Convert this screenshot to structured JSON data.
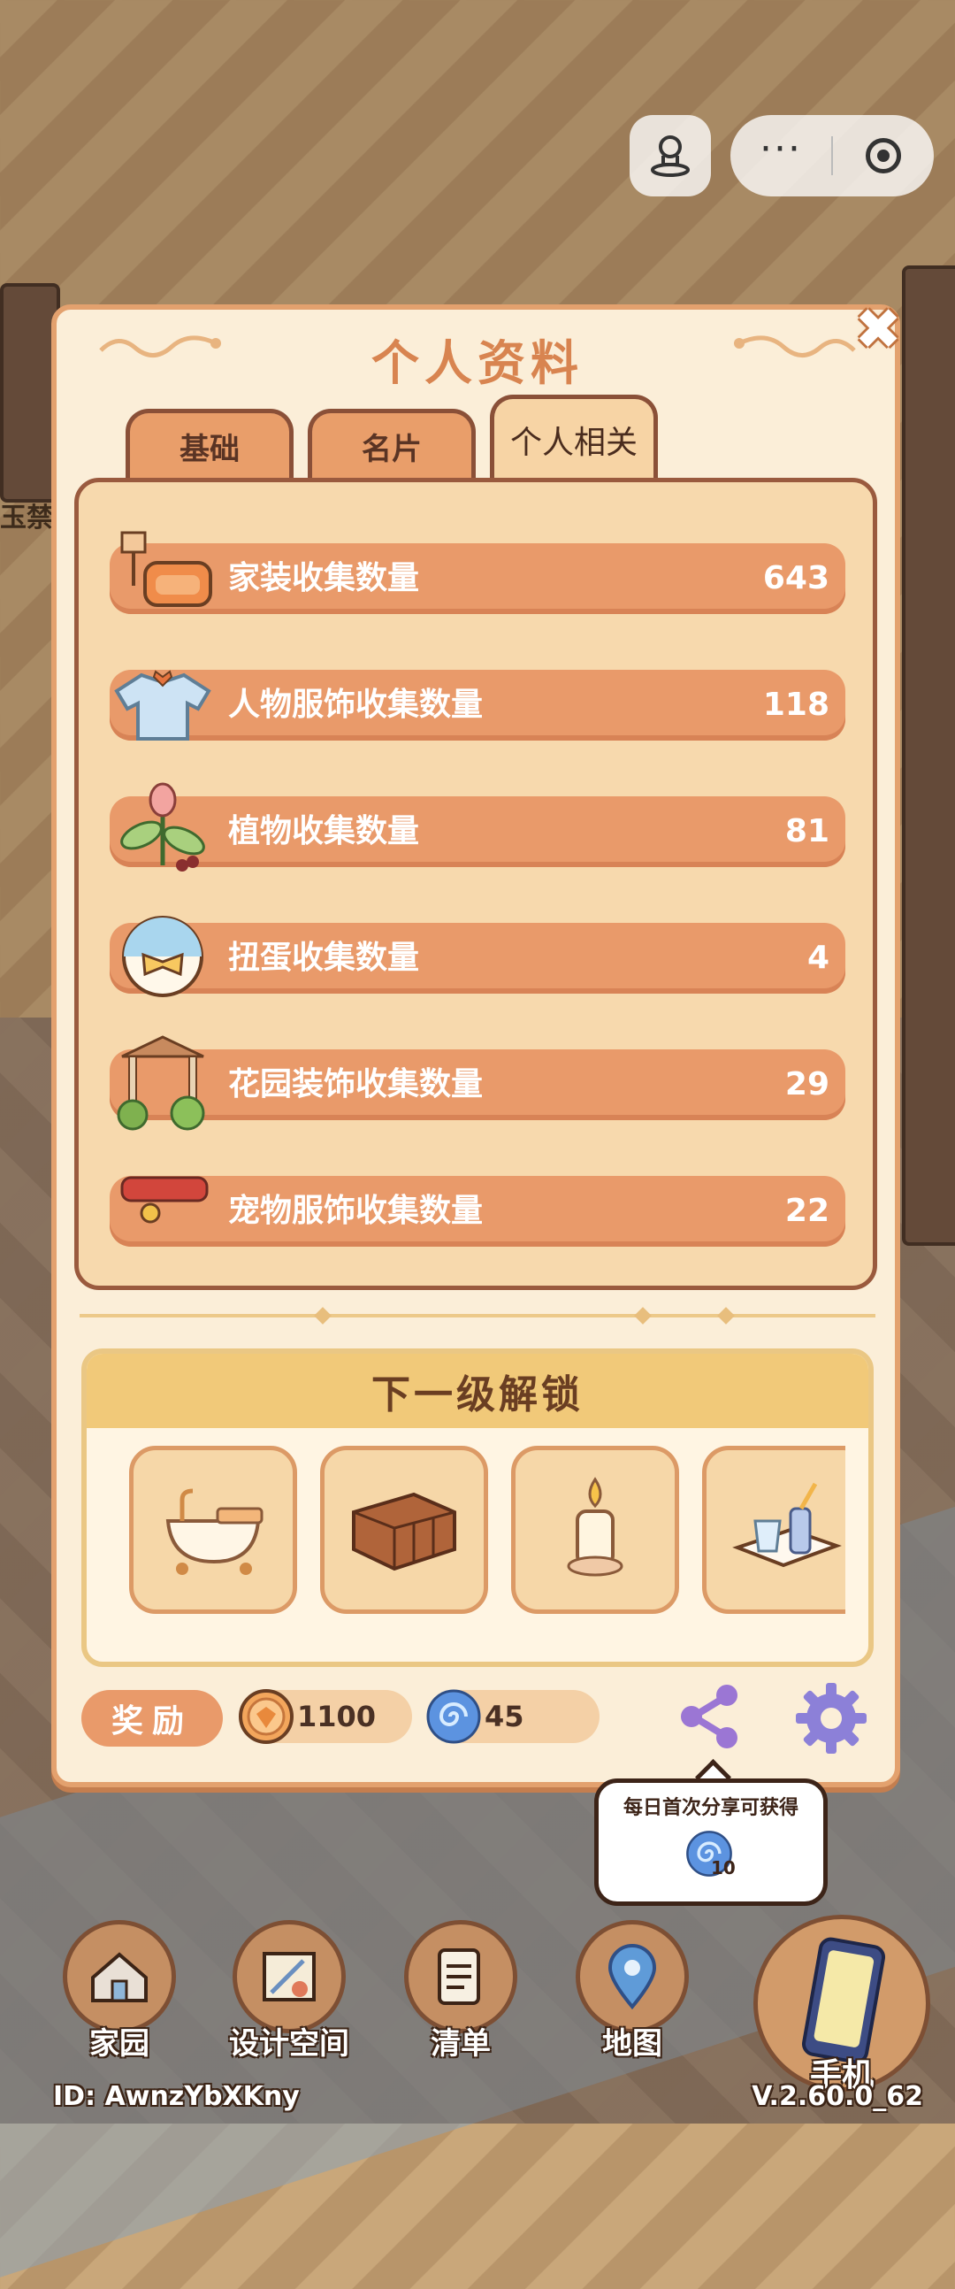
{
  "background": {
    "side_tag": "玉禁"
  },
  "top_bar": {
    "more_glyph": "···",
    "avatar_icon": "person-pin-icon",
    "record_icon": "record-icon"
  },
  "panel": {
    "title": "个人资料",
    "close_glyph": "✖",
    "tabs": [
      {
        "label": "基础",
        "active": false
      },
      {
        "label": "名片",
        "active": false
      },
      {
        "label": "个人相关",
        "active": true
      }
    ]
  },
  "stats": [
    {
      "label": "家装收集数量",
      "value": "643",
      "icon": "furniture-icon"
    },
    {
      "label": "人物服饰收集数量",
      "value": "118",
      "icon": "clothing-icon"
    },
    {
      "label": "植物收集数量",
      "value": "81",
      "icon": "plant-icon"
    },
    {
      "label": "扭蛋收集数量",
      "value": "4",
      "icon": "gacha-icon"
    },
    {
      "label": "花园装饰收集数量",
      "value": "29",
      "icon": "garden-icon"
    },
    {
      "label": "宠物服饰收集数量",
      "value": "22",
      "icon": "pet-collar-icon"
    }
  ],
  "unlock": {
    "title": "下一级解锁",
    "items": [
      "bathtub-icon",
      "cabinet-icon",
      "candle-icon",
      "drink-tray-icon"
    ]
  },
  "rewards": {
    "label": "奖励",
    "coins": "1100",
    "gems": "45"
  },
  "tooltip": {
    "text": "每日首次分享可获得",
    "amount": "10"
  },
  "nav": [
    {
      "label": "家园",
      "icon": "home-icon"
    },
    {
      "label": "设计空间",
      "icon": "design-icon"
    },
    {
      "label": "清单",
      "icon": "list-icon"
    },
    {
      "label": "地图",
      "icon": "map-pin-icon"
    }
  ],
  "phone": {
    "label": "手机",
    "icon": "phone-icon"
  },
  "footer": {
    "id": "ID: AwnzYbXKny",
    "version": "V.2.60.0_62"
  },
  "colors": {
    "panel_bg": "#fbeed8",
    "accent": "#e99a6a",
    "title": "#d88450"
  }
}
